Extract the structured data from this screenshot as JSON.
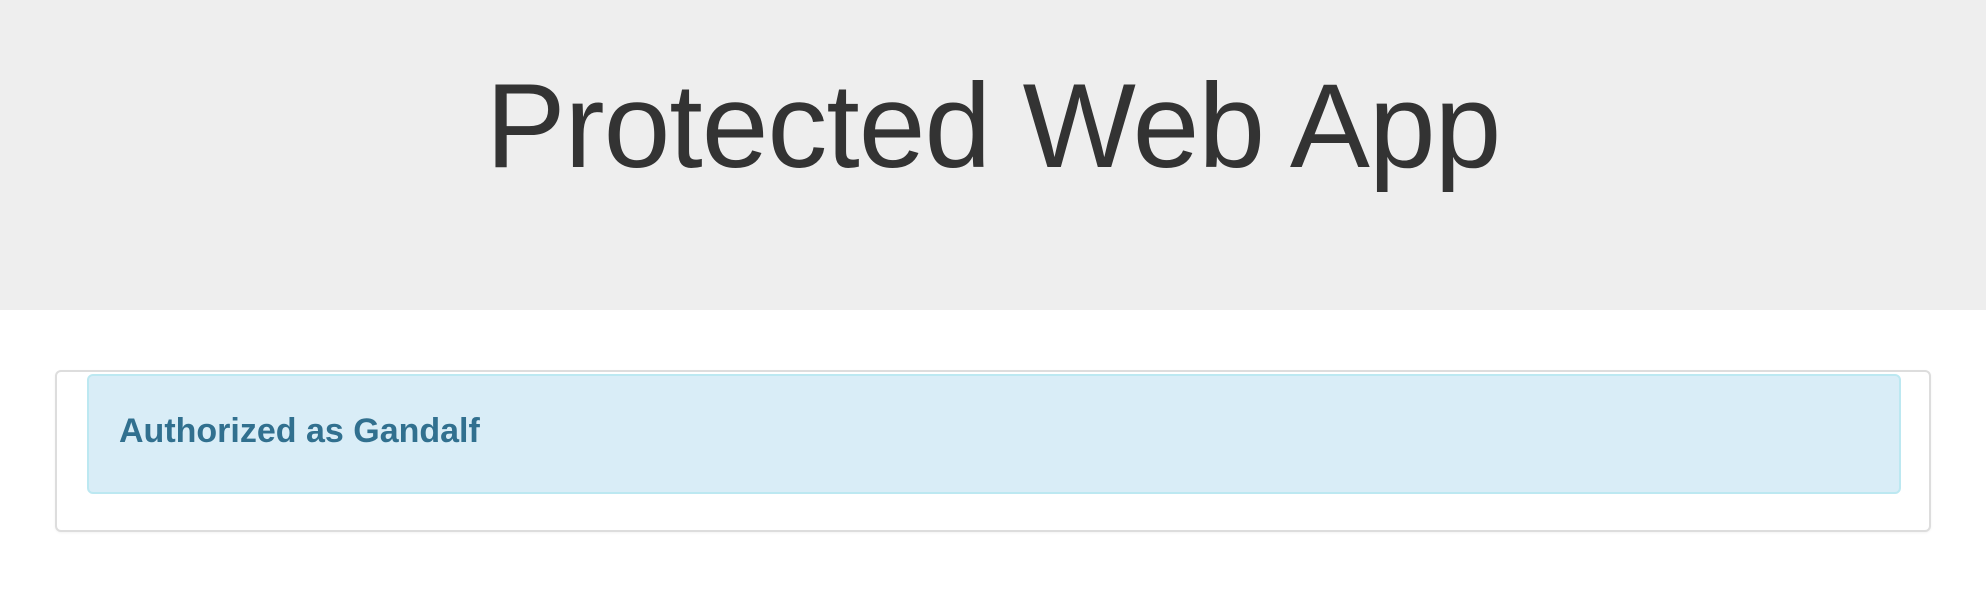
{
  "header": {
    "title": "Protected Web App"
  },
  "panel": {
    "alert": {
      "message": "Authorized as Gandalf"
    }
  },
  "colors": {
    "jumbotron_background": "#eeeeee",
    "title_text": "#333333",
    "alert_background": "#d9edf7",
    "alert_border": "#bce8f1",
    "alert_text": "#31708f",
    "panel_border": "#dddddd"
  }
}
